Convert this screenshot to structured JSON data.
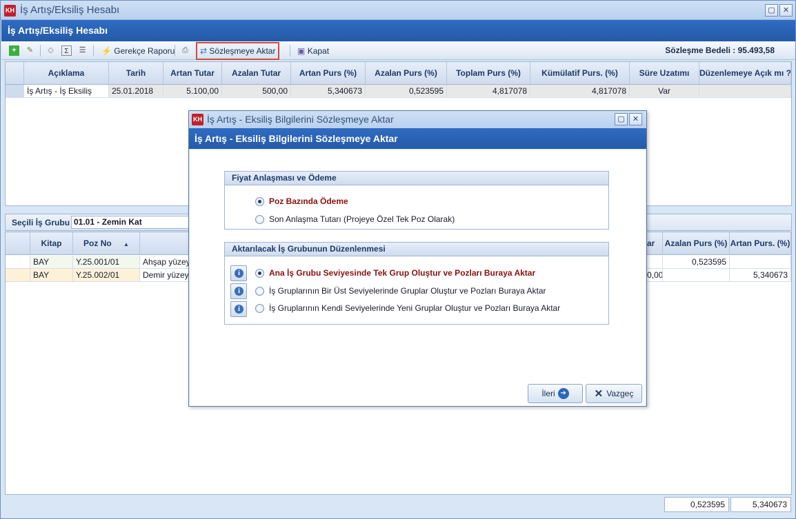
{
  "window": {
    "title": "İş Artış/Eksiliş Hesabı",
    "logo": "KH",
    "header": "İş Artış/Eksiliş Hesabı"
  },
  "toolbar": {
    "icons": [
      "add-icon",
      "edit-icon",
      "eraser-icon",
      "sum-icon",
      "report-icon"
    ],
    "gerekce_label": "Gerekçe Raporu",
    "aktar_label": "Sözleşmeye Aktar",
    "kapat_label": "Kapat",
    "contract_total": "Sözleşme Bedeli : 95.493,58"
  },
  "top_grid": {
    "columns": [
      "Açıklama",
      "Tarih",
      "Artan Tutar",
      "Azalan Tutar",
      "Artan Purs (%)",
      "Azalan Purs (%)",
      "Toplam Purs (%)",
      "Kümülatif Purs. (%)",
      "Süre Uzatımı",
      "Düzenlemeye Açık mı ?"
    ],
    "rows": [
      [
        "İş Artış - İş Eksiliş",
        "25.01.2018",
        "5.100,00",
        "500,00",
        "5,340673",
        "0,523595",
        "4,817078",
        "4,817078",
        "Var",
        ""
      ]
    ]
  },
  "group": {
    "label": "Seçili İş Grubu",
    "value": "01.01 - Zemin Kat"
  },
  "bottom_grid": {
    "columns": [
      "Kitap",
      "Poz No",
      "",
      "ar",
      "Azalan Purs (%)",
      "Artan Purs. (%)"
    ],
    "rows": [
      [
        "BAY",
        "Y.25.001/01",
        "Ahşap yüzeyl",
        "",
        "0,523595",
        ""
      ],
      [
        "BAY",
        "Y.25.002/01",
        "Demir yüzeyl",
        "0,00",
        "",
        "5,340673"
      ]
    ],
    "footer": [
      "0,523595",
      "5,340673"
    ]
  },
  "dialog": {
    "title": "İş Artış - Eksiliş Bilgilerini Sözleşmeye Aktar",
    "header": "İş Artış - Eksiliş Bilgilerini Sözleşmeye Aktar",
    "group1": {
      "title": "Fiyat Anlaşması ve Ödeme",
      "options": [
        "Poz Bazında Ödeme",
        "Son Anlaşma Tutarı (Projeye Özel Tek Poz Olarak)"
      ]
    },
    "group2": {
      "title": "Aktarılacak İş Grubunun Düzenlenmesi",
      "options": [
        "Ana İş Grubu Seviyesinde Tek Grup Oluştur ve Pozları Buraya Aktar",
        "İş Gruplarının Bir Üst Seviyelerinde Gruplar Oluştur ve Pozları Buraya Aktar",
        "İş Gruplarının Kendi Seviyelerinde Yeni Gruplar Oluştur ve Pozları Buraya Aktar"
      ]
    },
    "next_label": "İleri",
    "cancel_label": "Vazgeç"
  }
}
